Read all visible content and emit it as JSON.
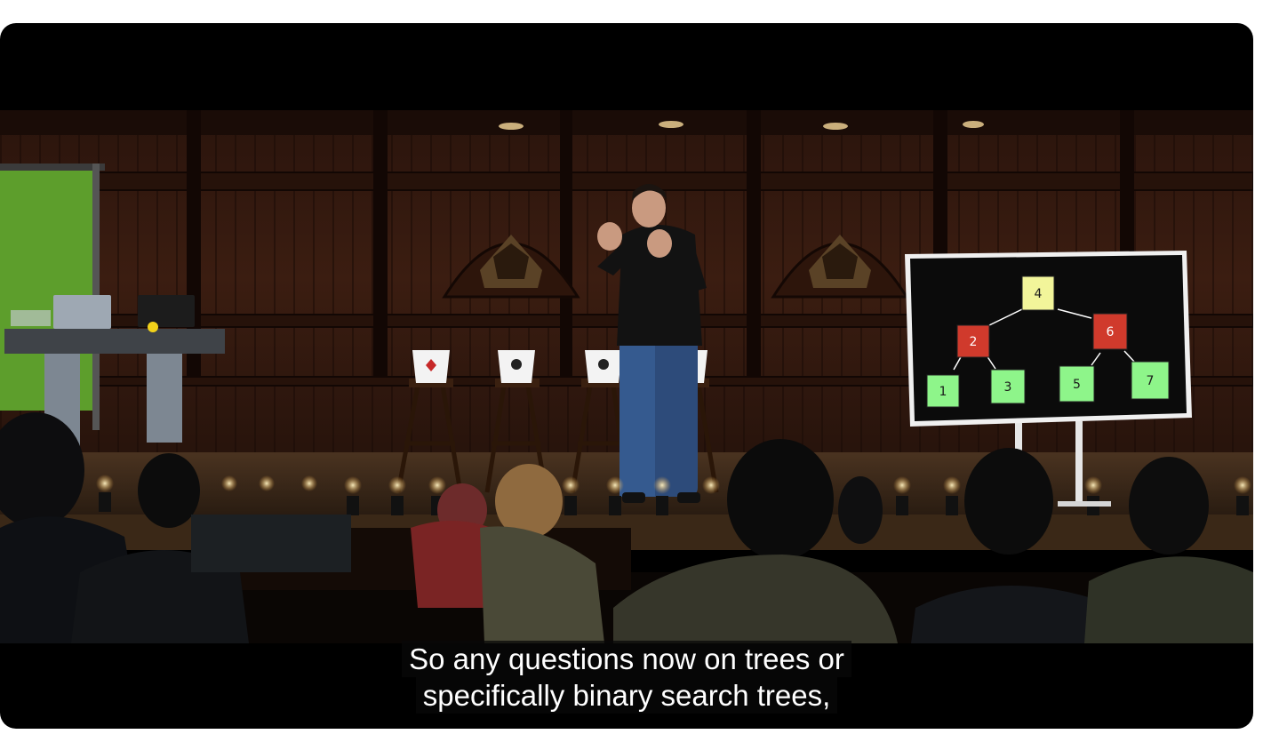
{
  "video": {
    "captions": [
      "So any questions now on trees or",
      "specifically binary search trees,"
    ],
    "board": {
      "nodes": [
        {
          "label": "4",
          "color": "#f2f59a"
        },
        {
          "label": "2",
          "color": "#d03a2c"
        },
        {
          "label": "6",
          "color": "#d03a2c"
        },
        {
          "label": "1",
          "color": "#8ef58a"
        },
        {
          "label": "3",
          "color": "#8ef58a"
        },
        {
          "label": "5",
          "color": "#8ef58a"
        },
        {
          "label": "7",
          "color": "#8ef58a"
        }
      ]
    }
  },
  "colors": {
    "player_bg": "#000000",
    "caption_bg": "#080808",
    "caption_text": "#ffffff",
    "wood": "#3a1d12"
  }
}
